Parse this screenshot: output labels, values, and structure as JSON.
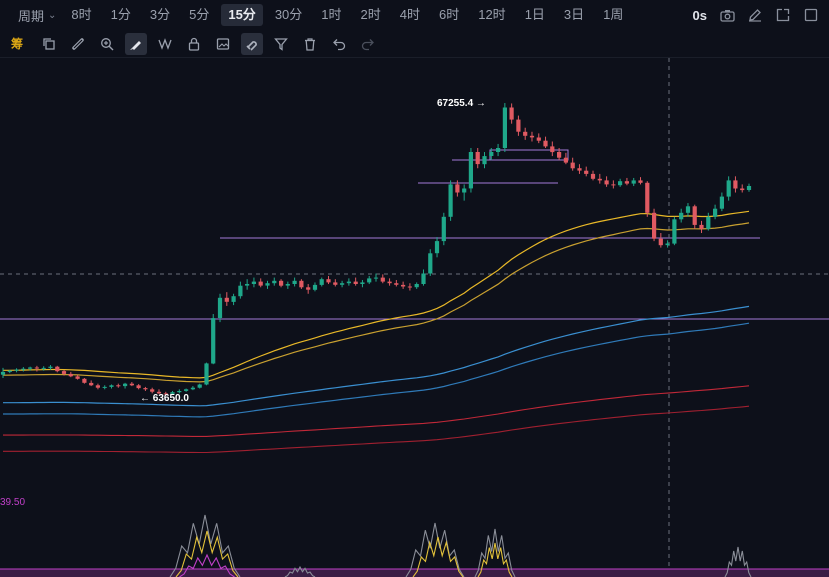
{
  "topbar": {
    "period_label": "周期",
    "timeframes": [
      "8时",
      "1分",
      "3分",
      "5分",
      "15分",
      "30分",
      "1时",
      "2时",
      "4时",
      "6时",
      "12时",
      "1日",
      "3日",
      "1周"
    ],
    "active_timeframe": "15分",
    "countdown": "0s"
  },
  "toolbar": {
    "chou_label": "筹",
    "tools": [
      "copy-icon",
      "ruler-icon",
      "zoom-in-icon",
      "brush-icon",
      "measure-icon",
      "lock-icon",
      "image-icon",
      "magnet-icon",
      "filter-icon",
      "trash-icon",
      "undo-icon",
      "redo-icon"
    ],
    "active_tool": "brush-icon"
  },
  "chart_data": {
    "type": "candlestick",
    "high_label": "67255.4",
    "low_label": "63650.0",
    "indicator_label": "39.50",
    "y_range": [
      63020,
      67600
    ],
    "colors": {
      "up": "#1fa88a",
      "down": "#e05a62",
      "ma_fast": "#e8b828",
      "ma_slow": "#c8a030",
      "ema_blue1": "#3a8fd0",
      "ema_blue2": "#2f7ab8",
      "ema_red1": "#c02838",
      "ema_red2": "#a02030",
      "hline": "#a47ad8",
      "osc_yellow": "#e2c23a",
      "osc_gray": "#8a8e98",
      "osc_purple": "#c040c8"
    },
    "candles": [
      [
        63900,
        63985,
        63860,
        63935
      ],
      [
        63935,
        63960,
        63920,
        63950
      ],
      [
        63950,
        63980,
        63930,
        63965
      ],
      [
        63965,
        63995,
        63940,
        63975
      ],
      [
        63975,
        64000,
        63950,
        63990
      ],
      [
        63990,
        64010,
        63940,
        63980
      ],
      [
        63980,
        64005,
        63950,
        63985
      ],
      [
        63985,
        64020,
        63960,
        64000
      ],
      [
        64000,
        64010,
        63930,
        63945
      ],
      [
        63945,
        63960,
        63890,
        63910
      ],
      [
        63910,
        63935,
        63870,
        63880
      ],
      [
        63880,
        63900,
        63840,
        63850
      ],
      [
        63850,
        63860,
        63790,
        63800
      ],
      [
        63800,
        63830,
        63760,
        63770
      ],
      [
        63770,
        63790,
        63720,
        63740
      ],
      [
        63740,
        63770,
        63720,
        63750
      ],
      [
        63750,
        63780,
        63730,
        63770
      ],
      [
        63770,
        63790,
        63740,
        63760
      ],
      [
        63760,
        63800,
        63730,
        63790
      ],
      [
        63790,
        63810,
        63760,
        63770
      ],
      [
        63770,
        63785,
        63720,
        63735
      ],
      [
        63735,
        63750,
        63700,
        63720
      ],
      [
        63720,
        63740,
        63670,
        63690
      ],
      [
        63690,
        63720,
        63660,
        63670
      ],
      [
        63670,
        63690,
        63650,
        63665
      ],
      [
        63665,
        63700,
        63650,
        63685
      ],
      [
        63685,
        63720,
        63670,
        63700
      ],
      [
        63700,
        63730,
        63690,
        63720
      ],
      [
        63720,
        63760,
        63710,
        63740
      ],
      [
        63740,
        63790,
        63730,
        63780
      ],
      [
        63780,
        64050,
        63770,
        64040
      ],
      [
        64040,
        64650,
        64030,
        64600
      ],
      [
        64600,
        64900,
        64550,
        64850
      ],
      [
        64850,
        64920,
        64750,
        64800
      ],
      [
        64800,
        64900,
        64760,
        64870
      ],
      [
        64870,
        65050,
        64840,
        65000
      ],
      [
        65000,
        65080,
        64950,
        65020
      ],
      [
        65020,
        65100,
        64980,
        65050
      ],
      [
        65050,
        65090,
        64980,
        65000
      ],
      [
        65000,
        65060,
        64960,
        65030
      ],
      [
        65030,
        65100,
        65000,
        65060
      ],
      [
        65060,
        65080,
        64980,
        65000
      ],
      [
        65000,
        65050,
        64960,
        65020
      ],
      [
        65020,
        65100,
        64990,
        65060
      ],
      [
        65060,
        65080,
        64960,
        64980
      ],
      [
        64980,
        65020,
        64900,
        64950
      ],
      [
        64950,
        65040,
        64930,
        65010
      ],
      [
        65010,
        65100,
        64990,
        65080
      ],
      [
        65080,
        65120,
        65020,
        65040
      ],
      [
        65040,
        65080,
        64990,
        65010
      ],
      [
        65010,
        65060,
        64980,
        65030
      ],
      [
        65030,
        65090,
        65000,
        65050
      ],
      [
        65050,
        65100,
        65000,
        65020
      ],
      [
        65020,
        65070,
        64980,
        65040
      ],
      [
        65040,
        65120,
        65020,
        65090
      ],
      [
        65090,
        65150,
        65050,
        65100
      ],
      [
        65100,
        65140,
        65030,
        65050
      ],
      [
        65050,
        65090,
        65000,
        65030
      ],
      [
        65030,
        65070,
        64990,
        65010
      ],
      [
        65010,
        65050,
        64960,
        64990
      ],
      [
        64990,
        65030,
        64940,
        64980
      ],
      [
        64980,
        65040,
        64960,
        65020
      ],
      [
        65020,
        65200,
        65000,
        65150
      ],
      [
        65150,
        65450,
        65120,
        65400
      ],
      [
        65400,
        65600,
        65350,
        65550
      ],
      [
        65550,
        65900,
        65500,
        65850
      ],
      [
        65850,
        66300,
        65800,
        66250
      ],
      [
        66250,
        66300,
        66100,
        66150
      ],
      [
        66150,
        66250,
        66050,
        66200
      ],
      [
        66200,
        66700,
        66150,
        66650
      ],
      [
        66650,
        66700,
        66450,
        66500
      ],
      [
        66500,
        66650,
        66450,
        66600
      ],
      [
        66600,
        66700,
        66550,
        66650
      ],
      [
        66650,
        66750,
        66600,
        66700
      ],
      [
        66700,
        67255,
        66650,
        67200
      ],
      [
        67200,
        67250,
        67000,
        67050
      ],
      [
        67050,
        67100,
        66850,
        66900
      ],
      [
        66900,
        66950,
        66800,
        66850
      ],
      [
        66850,
        66900,
        66780,
        66830
      ],
      [
        66830,
        66880,
        66760,
        66790
      ],
      [
        66790,
        66840,
        66700,
        66720
      ],
      [
        66720,
        66780,
        66600,
        66650
      ],
      [
        66650,
        66700,
        66550,
        66580
      ],
      [
        66580,
        66640,
        66500,
        66520
      ],
      [
        66520,
        66580,
        66420,
        66450
      ],
      [
        66450,
        66500,
        66380,
        66420
      ],
      [
        66420,
        66470,
        66350,
        66380
      ],
      [
        66380,
        66420,
        66300,
        66320
      ],
      [
        66320,
        66380,
        66260,
        66300
      ],
      [
        66300,
        66350,
        66220,
        66250
      ],
      [
        66250,
        66300,
        66200,
        66240
      ],
      [
        66240,
        66320,
        66220,
        66290
      ],
      [
        66290,
        66330,
        66240,
        66260
      ],
      [
        66260,
        66330,
        66230,
        66300
      ],
      [
        66300,
        66340,
        66250,
        66270
      ],
      [
        66270,
        66290,
        65850,
        65900
      ],
      [
        65900,
        65950,
        65550,
        65580
      ],
      [
        65580,
        65650,
        65470,
        65500
      ],
      [
        65500,
        65560,
        65470,
        65520
      ],
      [
        65520,
        65850,
        65500,
        65820
      ],
      [
        65820,
        65950,
        65780,
        65900
      ],
      [
        65900,
        66020,
        65850,
        65980
      ],
      [
        65980,
        66000,
        65700,
        65750
      ],
      [
        65750,
        65800,
        65650,
        65700
      ],
      [
        65700,
        65900,
        65680,
        65850
      ],
      [
        65850,
        66000,
        65820,
        65950
      ],
      [
        65950,
        66150,
        65920,
        66100
      ],
      [
        66100,
        66350,
        66050,
        66300
      ],
      [
        66300,
        66350,
        66150,
        66200
      ],
      [
        66200,
        66250,
        66150,
        66180
      ],
      [
        66180,
        66260,
        66160,
        66230
      ]
    ]
  }
}
